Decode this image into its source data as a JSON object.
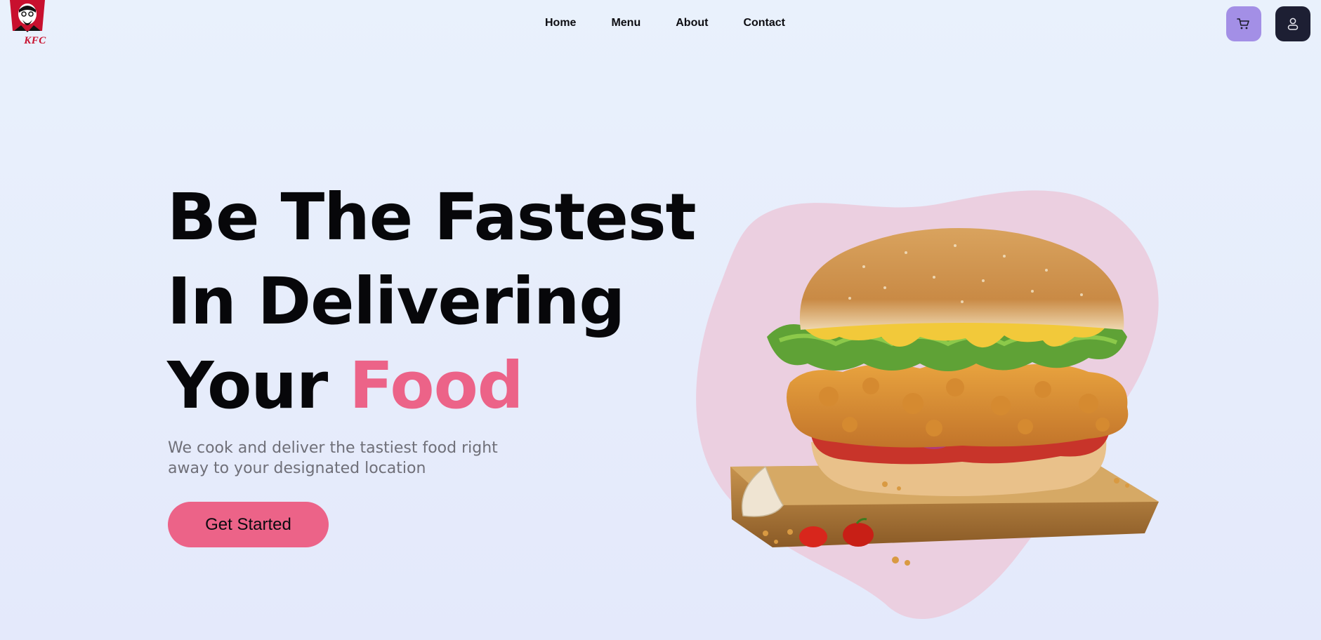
{
  "brand": {
    "logo_text": "KFC",
    "accent_color": "#ec6388",
    "logo_red": "#c8102e"
  },
  "nav": {
    "items": [
      {
        "label": "Home"
      },
      {
        "label": "Menu"
      },
      {
        "label": "About"
      },
      {
        "label": "Contact"
      }
    ]
  },
  "header_actions": {
    "cart_icon": "cart-icon",
    "user_icon": "user-icon",
    "cart_bg": "#a38fe6",
    "user_bg": "#1d1f33"
  },
  "hero": {
    "title_line1": "Be The Fastest",
    "title_line2": "In Delivering",
    "title_line3_prefix": "Your",
    "title_line3_accent": "Food",
    "subtitle": "We cook and deliver the tastiest food right away to your designated location",
    "cta_label": "Get Started",
    "blob_color": "#ebcfe0"
  }
}
